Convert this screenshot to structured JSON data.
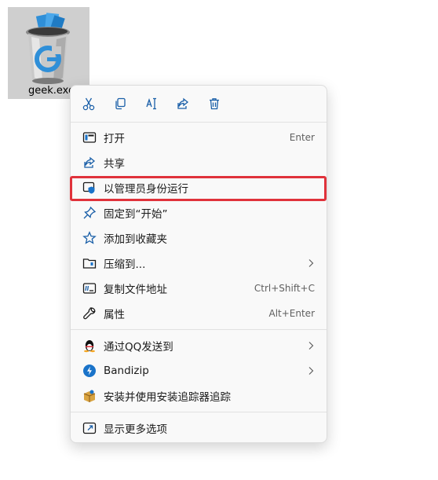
{
  "file": {
    "label": "geek.exe",
    "icon": "recycle-bin-g-icon"
  },
  "toolbar": [
    {
      "name": "cut-button",
      "icon": "scissors-icon"
    },
    {
      "name": "copy-button",
      "icon": "copy-icon"
    },
    {
      "name": "rename-button",
      "icon": "rename-icon"
    },
    {
      "name": "share-button",
      "icon": "share-icon"
    },
    {
      "name": "delete-button",
      "icon": "trash-icon"
    }
  ],
  "menu": {
    "open": {
      "label": "打开",
      "shortcut": "Enter"
    },
    "share": {
      "label": "共享"
    },
    "run_as_admin": {
      "label": "以管理员身份运行"
    },
    "pin_start": {
      "label": "固定到“开始”"
    },
    "add_favorites": {
      "label": "添加到收藏夹"
    },
    "compress": {
      "label": "压缩到..."
    },
    "copy_path": {
      "label": "复制文件地址",
      "shortcut": "Ctrl+Shift+C"
    },
    "properties": {
      "label": "属性",
      "shortcut": "Alt+Enter"
    },
    "send_qq": {
      "label": "通过QQ发送到"
    },
    "bandizip": {
      "label": "Bandizip"
    },
    "install_tracker": {
      "label": "安装并使用安装追踪器追踪"
    },
    "more_options": {
      "label": "显示更多选项"
    }
  },
  "colors": {
    "highlight": "#e0323b",
    "accent": "#1a73c9"
  }
}
